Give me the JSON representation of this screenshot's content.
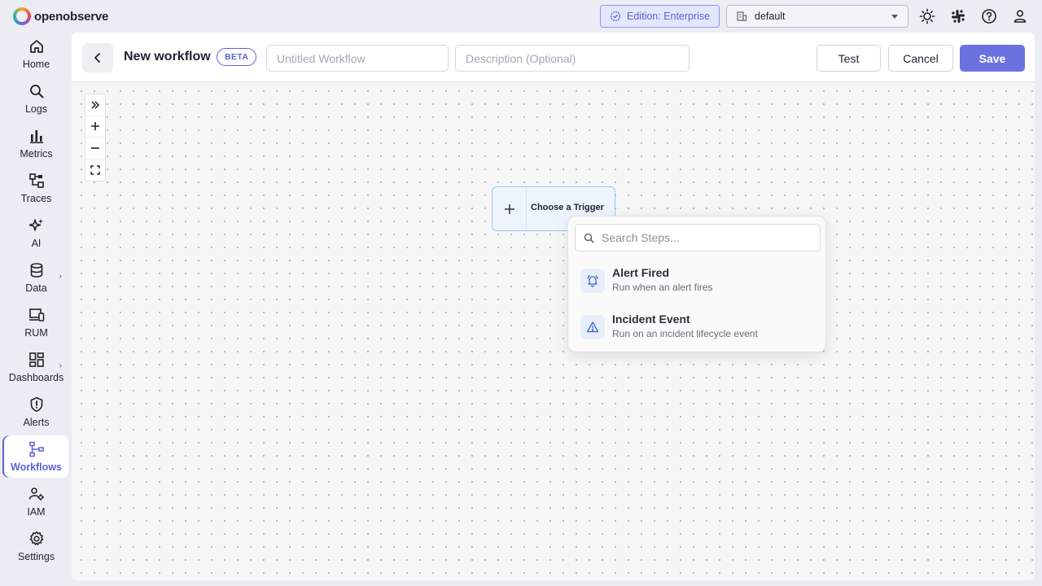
{
  "app": {
    "logo_text": "openobserve"
  },
  "topbar": {
    "edition_label": "Edition: Enterprise",
    "org_selector": "default",
    "icons": [
      "theme-toggle-icon",
      "slack-icon",
      "help-icon",
      "user-icon"
    ]
  },
  "sidebar": {
    "items": [
      {
        "label": "Home",
        "icon": "home-icon"
      },
      {
        "label": "Logs",
        "icon": "search-icon"
      },
      {
        "label": "Metrics",
        "icon": "bar-chart-icon"
      },
      {
        "label": "Traces",
        "icon": "traces-icon"
      },
      {
        "label": "AI",
        "icon": "sparkles-icon"
      },
      {
        "label": "Data",
        "icon": "database-icon",
        "expandable": true
      },
      {
        "label": "RUM",
        "icon": "devices-icon"
      },
      {
        "label": "Dashboards",
        "icon": "grid-icon",
        "expandable": true
      },
      {
        "label": "Alerts",
        "icon": "shield-alert-icon"
      },
      {
        "label": "Workflows",
        "icon": "workflow-icon",
        "active": true
      },
      {
        "label": "IAM",
        "icon": "user-gear-icon"
      },
      {
        "label": "Settings",
        "icon": "gear-icon"
      }
    ]
  },
  "header": {
    "title": "New workflow",
    "badge": "BETA",
    "name_placeholder": "Untitled Workflow",
    "name_value": "",
    "description_placeholder": "Description (Optional)",
    "description_value": "",
    "test_label": "Test",
    "cancel_label": "Cancel",
    "save_label": "Save"
  },
  "canvas": {
    "trigger_node_label": "Choose a Trigger",
    "zoom_controls": [
      "expand-panel-icon",
      "zoom-in-icon",
      "zoom-out-icon",
      "fit-view-icon"
    ]
  },
  "step_picker": {
    "search_placeholder": "Search Steps...",
    "steps": [
      {
        "title": "Alert Fired",
        "description": "Run when an alert fires",
        "icon": "alarm-bell-icon"
      },
      {
        "title": "Incident Event",
        "description": "Run on an incident lifecycle event",
        "icon": "warning-triangle-icon"
      }
    ]
  },
  "colors": {
    "accent": "#5b63d8",
    "save_button": "#6b72e0",
    "node_border": "#9ec4ef"
  }
}
